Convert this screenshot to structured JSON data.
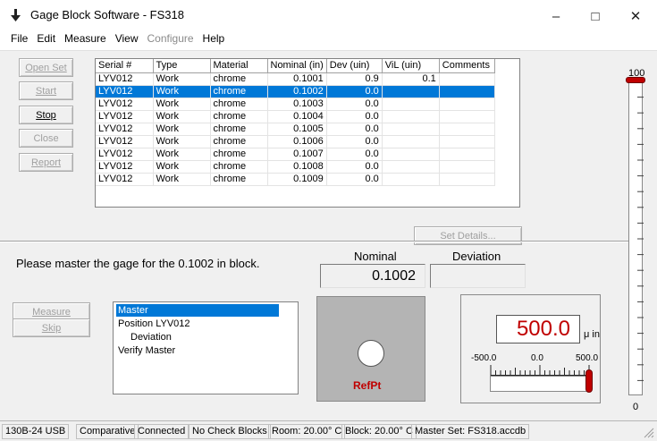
{
  "window": {
    "title": "Gage Block Software - FS318",
    "app_icon": "arrow-down-icon",
    "minimize_glyph": "–",
    "maximize_glyph": "□",
    "close_glyph": "✕"
  },
  "menu": [
    {
      "label": "File",
      "enabled": true
    },
    {
      "label": "Edit",
      "enabled": true
    },
    {
      "label": "Measure",
      "enabled": true
    },
    {
      "label": "View",
      "enabled": true
    },
    {
      "label": "Configure",
      "enabled": false
    },
    {
      "label": "Help",
      "enabled": true
    }
  ],
  "side_buttons": {
    "open_set": {
      "label": "Open Set",
      "enabled": false
    },
    "start": {
      "label": "Start",
      "enabled": false
    },
    "stop": {
      "label": "Stop",
      "enabled": true
    },
    "close": {
      "label": "Close",
      "enabled": false
    },
    "report": {
      "label": "Report",
      "enabled": false
    }
  },
  "grid": {
    "columns": [
      "Serial #",
      "Type",
      "Material",
      "Nominal (in)",
      "Dev (uin)",
      "ViL (uin)",
      "Comments"
    ],
    "rows": [
      [
        "LYV012",
        "Work",
        "chrome",
        "0.1001",
        "0.9",
        "0.1",
        ""
      ],
      [
        "LYV012",
        "Work",
        "chrome",
        "0.1002",
        "0.0",
        "",
        ""
      ],
      [
        "LYV012",
        "Work",
        "chrome",
        "0.1003",
        "0.0",
        "",
        ""
      ],
      [
        "LYV012",
        "Work",
        "chrome",
        "0.1004",
        "0.0",
        "",
        ""
      ],
      [
        "LYV012",
        "Work",
        "chrome",
        "0.1005",
        "0.0",
        "",
        ""
      ],
      [
        "LYV012",
        "Work",
        "chrome",
        "0.1006",
        "0.0",
        "",
        ""
      ],
      [
        "LYV012",
        "Work",
        "chrome",
        "0.1007",
        "0.0",
        "",
        ""
      ],
      [
        "LYV012",
        "Work",
        "chrome",
        "0.1008",
        "0.0",
        "",
        ""
      ],
      [
        "LYV012",
        "Work",
        "chrome",
        "0.1009",
        "0.0",
        "",
        ""
      ]
    ],
    "selected_row_index": 1
  },
  "set_details": {
    "label": "Set Details...",
    "enabled": false
  },
  "instruction": "Please master the gage for the 0.1002 in block.",
  "nominal": {
    "label": "Nominal",
    "value": "0.1002"
  },
  "deviation": {
    "label": "Deviation",
    "value": ""
  },
  "measure_buttons": {
    "measure": {
      "label": "Measure",
      "enabled": false
    },
    "skip": {
      "label": "Skip",
      "enabled": false
    }
  },
  "steps": [
    "Master",
    "Position LYV012",
    "Deviation",
    "Verify Master"
  ],
  "selected_step": 0,
  "refpt": {
    "label": "RefPt"
  },
  "gauge": {
    "reading": "500.0",
    "unit": "μ in",
    "min_label": "-500.0",
    "mid_label": "0.0",
    "max_label": "500.0",
    "level": 1.0
  },
  "vertical_gauge": {
    "max_label": "100",
    "min_label": "0",
    "level": 1.0
  },
  "status": [
    "130B-24 USB",
    "Comparative",
    "Connected",
    "No Check Blocks",
    "Room: 20.00° C",
    "Block: 20.00° C",
    "Master Set: FS318.accdb"
  ],
  "colors": {
    "selection": "#0078d7",
    "indicator_red": "#c00000"
  }
}
